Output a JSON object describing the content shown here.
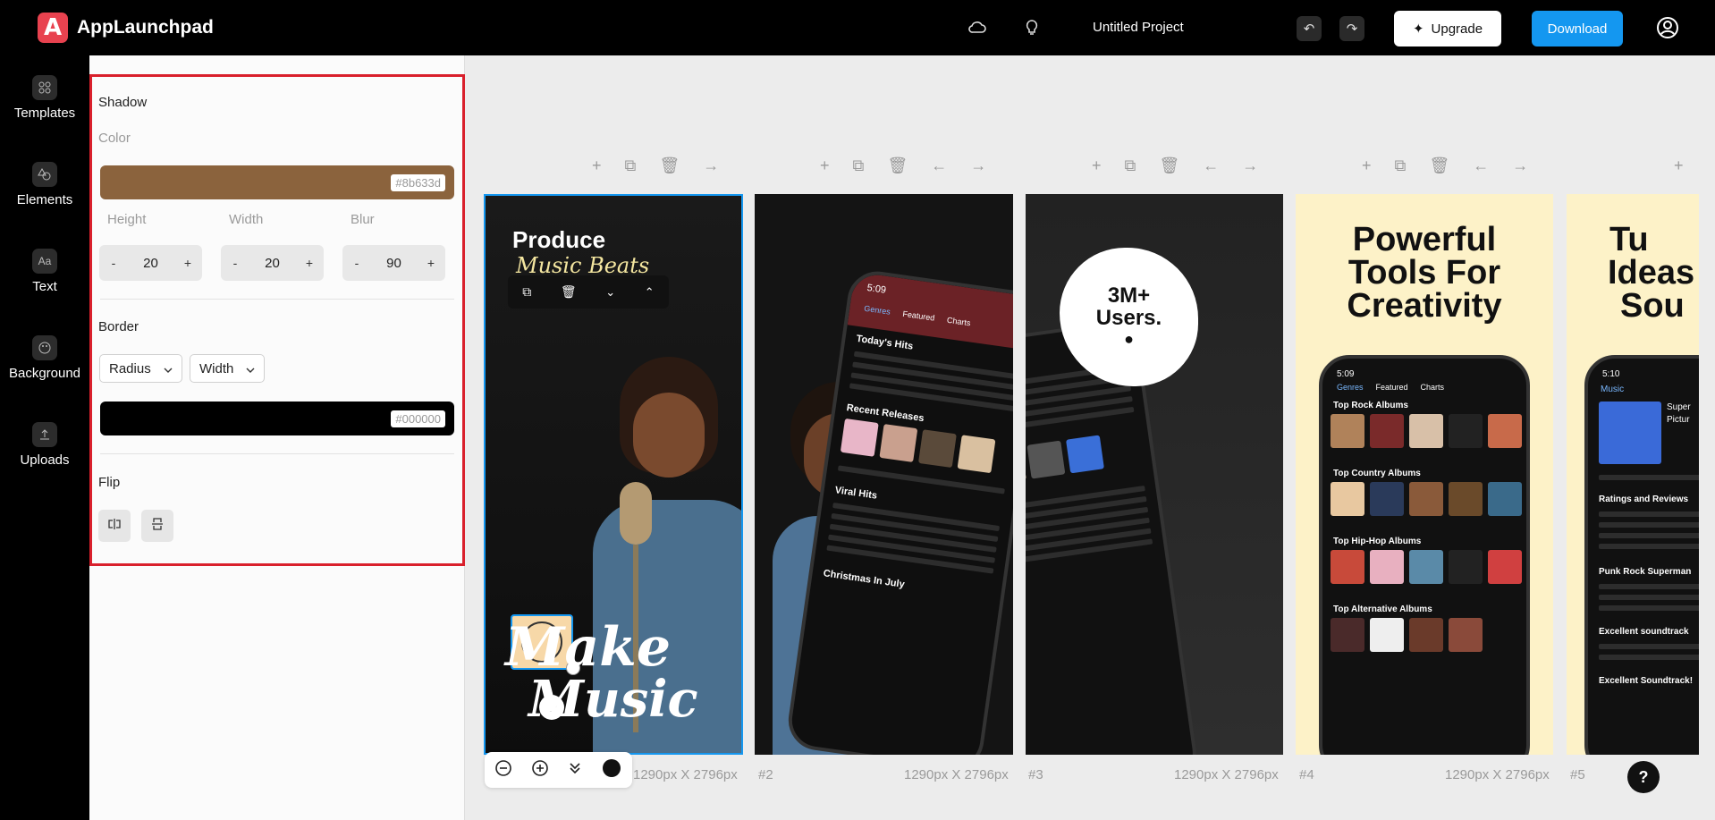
{
  "app": {
    "name": "AppLaunchpad",
    "logo_letter": "A"
  },
  "header": {
    "project_title": "Untitled Project",
    "upgrade_label": "Upgrade",
    "download_label": "Download"
  },
  "sidebar": {
    "items": [
      {
        "label": "Templates",
        "icon": "grid-icon"
      },
      {
        "label": "Elements",
        "icon": "shapes-icon"
      },
      {
        "label": "Text",
        "icon": "text-icon",
        "glyph": "Aa"
      },
      {
        "label": "Background",
        "icon": "palette-icon"
      },
      {
        "label": "Uploads",
        "icon": "upload-icon"
      }
    ]
  },
  "panel": {
    "shadow_label": "Shadow",
    "color_label": "Color",
    "shadow_color": "#8b633d",
    "height_label": "Height",
    "width_label": "Width",
    "blur_label": "Blur",
    "height_value": "20",
    "width_value": "20",
    "blur_value": "90",
    "minus": "-",
    "plus": "+",
    "border_label": "Border",
    "radius_dropdown": "Radius",
    "width_dropdown": "Width",
    "border_color": "#000000",
    "flip_label": "Flip"
  },
  "canvas": {
    "frames": [
      {
        "label": "",
        "size": "1290px X 2796px",
        "headline1": "Produce",
        "headline2": "Music Beats",
        "bottom1": "Make",
        "bottom2": "Music"
      },
      {
        "label": "#2",
        "size": "1290px X 2796px",
        "time": "5:09",
        "tab1": "Genres",
        "tab2": "Featured",
        "tab3": "Charts",
        "section1": "Today's Hits",
        "section2": "Recent Releases",
        "section3": "Viral Hits",
        "section4": "Christmas In July"
      },
      {
        "label": "#3",
        "size": "1290px X 2796px",
        "badge1": "3M+",
        "badge2": "Users."
      },
      {
        "label": "#4",
        "size": "1290px X 2796px",
        "headline1": "Powerful",
        "headline2": "Tools For",
        "headline3": "Creativity",
        "time": "5:09",
        "tab1": "Genres",
        "tab2": "Featured",
        "tab3": "Charts",
        "section1": "Top Rock Albums",
        "section2": "Top Country Albums",
        "section3": "Top Hip-Hop Albums",
        "section4": "Top Alternative Albums"
      },
      {
        "label": "#5",
        "size": "",
        "headline1": "Tu",
        "headline2": "Ideas",
        "headline3": "Sou",
        "time": "5:10",
        "back": "Music",
        "line1": "Super",
        "line2": "Pictur",
        "section1": "Ratings and Reviews",
        "review1": "Punk Rock Superman",
        "review2": "Excellent soundtrack",
        "review3": "Excellent Soundtrack!"
      }
    ]
  },
  "zoom": {
    "minus": "−",
    "plus": "+"
  },
  "help": "?",
  "colors": {
    "accent": "#1497f0",
    "logo": "#e8424f",
    "highlight_box": "#d9202c",
    "frame4_bg": "#fdf2c8"
  }
}
